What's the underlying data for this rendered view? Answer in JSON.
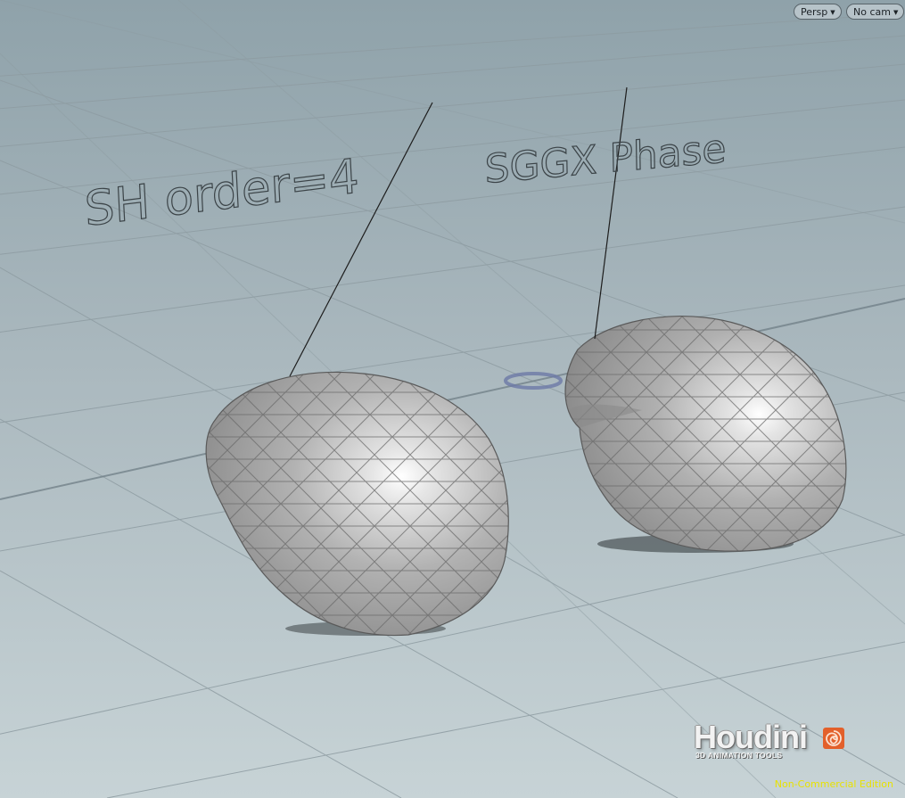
{
  "viewport": {
    "camera_menu": "Persp",
    "lens_menu": "No cam",
    "labels": {
      "left": "SH order=4",
      "right": "SGGX Phase"
    }
  },
  "branding": {
    "logo_name": "Houdini",
    "logo_tagline": "3D ANIMATION TOOLS",
    "edition": "Non-Commercial Edition"
  },
  "colors": {
    "edition_text": "#e8e200",
    "background_top": "#8fa2aa",
    "background_bottom": "#c7d3d6"
  }
}
